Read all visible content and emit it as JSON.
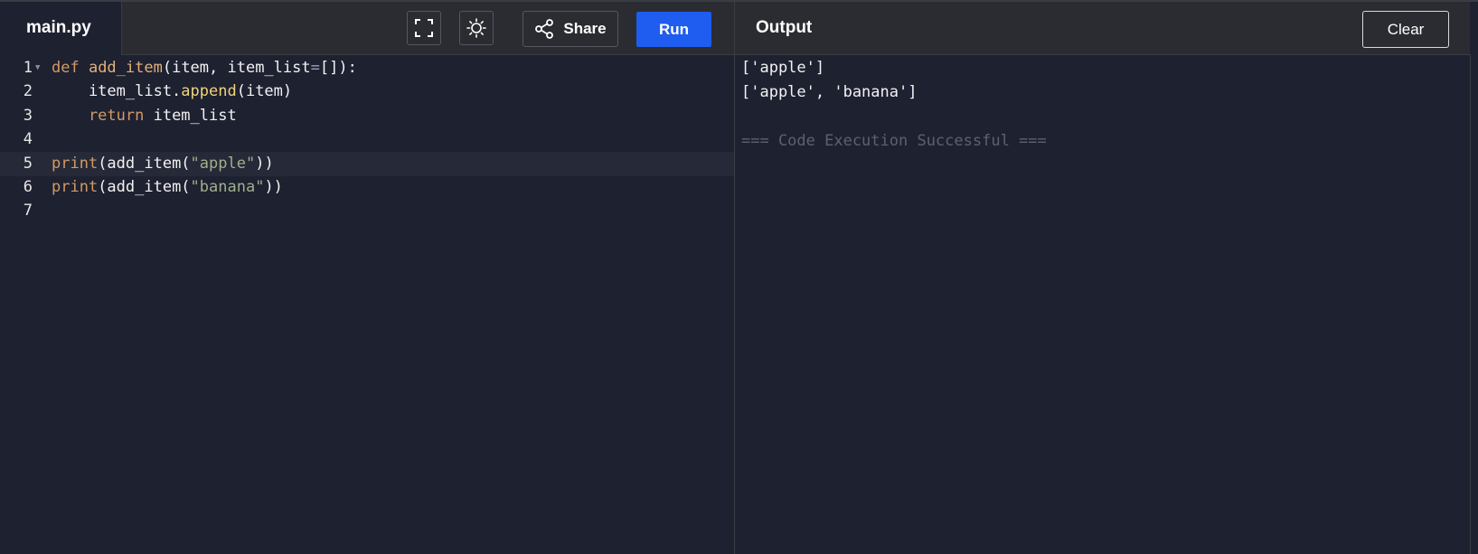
{
  "header": {
    "file_tab": "main.py",
    "share_label": "Share",
    "run_label": "Run",
    "output_title": "Output",
    "clear_label": "Clear",
    "icons": [
      "fullscreen-icon",
      "theme-sun-icon",
      "share-icon"
    ]
  },
  "editor": {
    "active_line": 5,
    "lines": [
      {
        "num": "1",
        "tokens": [
          [
            "kw",
            "def "
          ],
          [
            "fn",
            "add_item"
          ],
          [
            "",
            "(item, item_list"
          ],
          [
            "op",
            "="
          ],
          [
            "",
            "[]):"
          ]
        ]
      },
      {
        "num": "2",
        "tokens": [
          [
            "",
            "    item_list."
          ],
          [
            "meth",
            "append"
          ],
          [
            "",
            "(item)"
          ]
        ]
      },
      {
        "num": "3",
        "tokens": [
          [
            "kw",
            "    return "
          ],
          [
            "",
            "item_list"
          ]
        ]
      },
      {
        "num": "4",
        "tokens": []
      },
      {
        "num": "5",
        "tokens": [
          [
            "kw",
            "print"
          ],
          [
            "",
            "(add_item("
          ],
          [
            "str",
            "\"apple\""
          ],
          [
            "",
            "))"
          ]
        ]
      },
      {
        "num": "6",
        "tokens": [
          [
            "kw",
            "print"
          ],
          [
            "",
            "(add_item("
          ],
          [
            "str",
            "\"banana\""
          ],
          [
            "",
            "))"
          ]
        ]
      },
      {
        "num": "7",
        "tokens": []
      }
    ]
  },
  "output": {
    "lines": [
      "['apple']",
      "['apple', 'banana']",
      "",
      "=== Code Execution Successful ==="
    ]
  },
  "colors": {
    "run_button": "#1f5cf0",
    "background": "#1e2130",
    "header": "#2b2c31"
  }
}
